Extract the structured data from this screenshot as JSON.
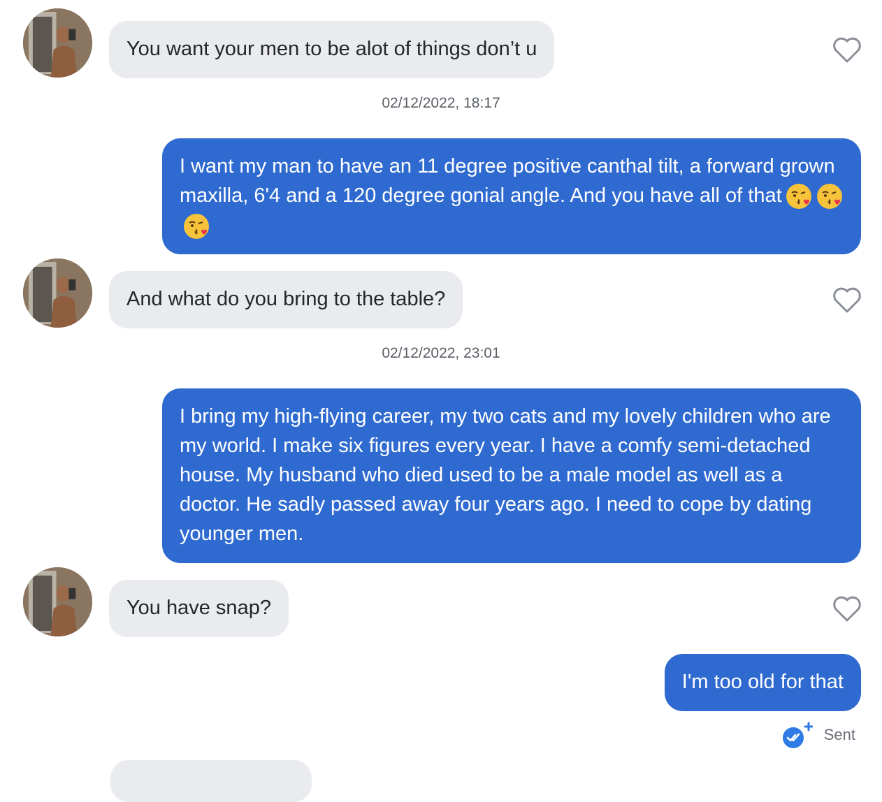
{
  "messages": [
    {
      "direction": "in",
      "text": "You want your men to be alot of things don’t u"
    },
    {
      "timestamp": "02/12/2022, 18:17"
    },
    {
      "direction": "out",
      "text_line": "I want my man to have an 11 degree positive canthal tilt, a forward grown maxilla, 6'4 and a 120 degree gonial angle. And you have all of that",
      "emojis": [
        "kissing-heart-emoji",
        "kissing-heart-emoji",
        "kissing-heart-emoji"
      ]
    },
    {
      "direction": "in",
      "text": "And what do you bring to the table?"
    },
    {
      "timestamp": "02/12/2022, 23:01"
    },
    {
      "direction": "out",
      "text": "I bring my high-flying career, my two cats and my lovely children who are my world. I make six figures every year. I have a comfy semi-detached house. My husband who died used to be a male model as well as a doctor. He sadly passed away four years ago. I need to cope by dating younger men."
    },
    {
      "direction": "in",
      "text": "You have snap?"
    },
    {
      "direction": "out",
      "text": "I'm too old for that"
    }
  ],
  "status": {
    "label": "Sent",
    "icon": "double-check-icon"
  },
  "colors": {
    "outgoing": "#2f6ad0",
    "incoming": "#eaebee",
    "heart": "#8a8e96",
    "badge": "#2f7be6"
  }
}
